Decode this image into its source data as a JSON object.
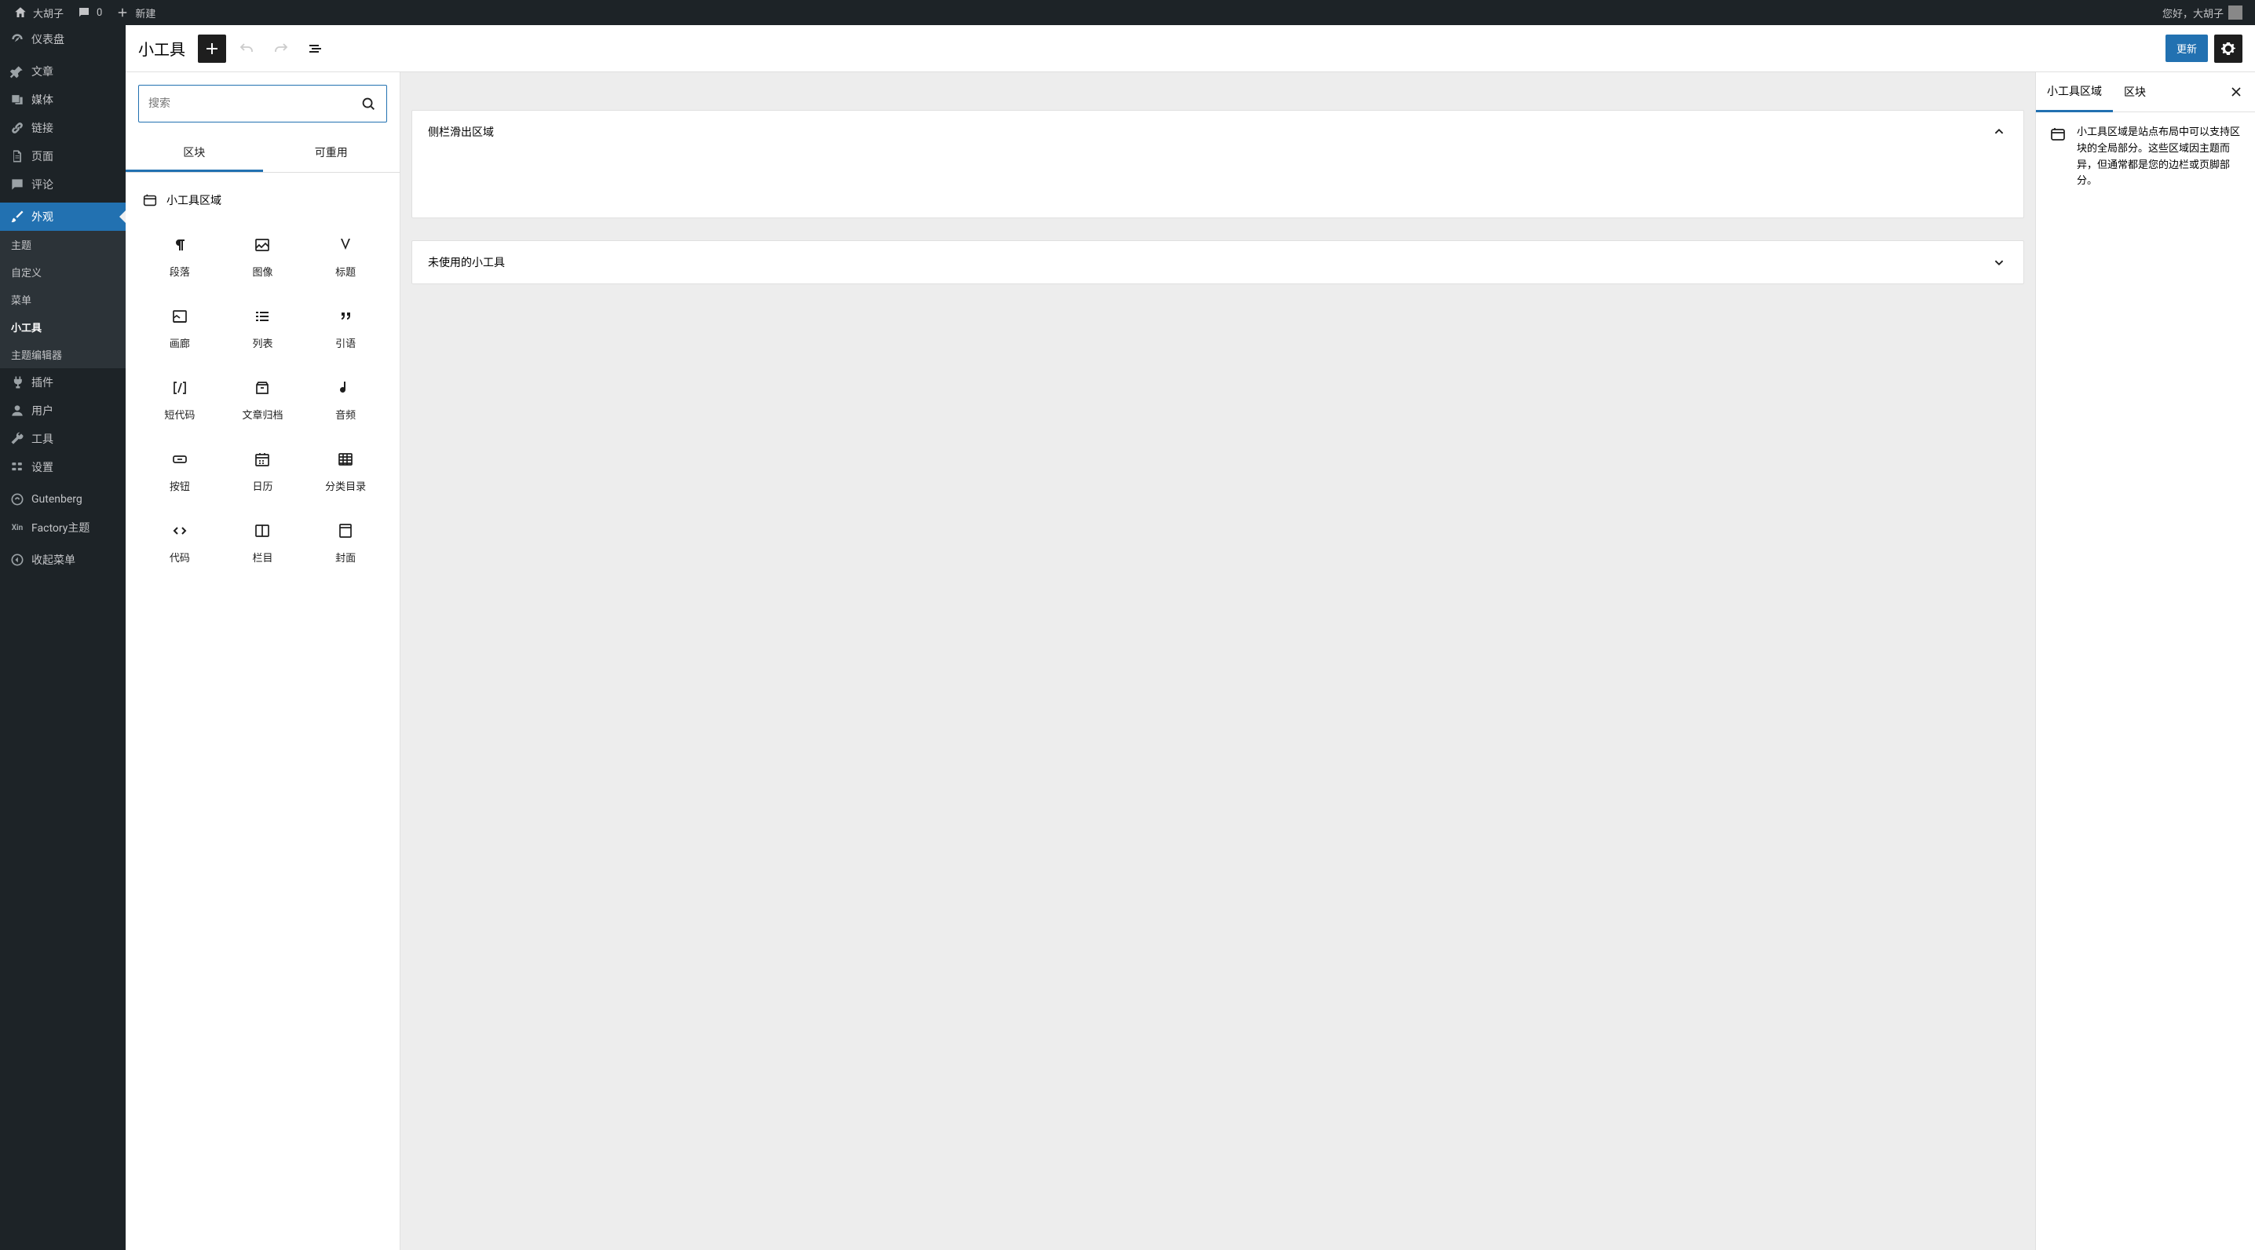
{
  "admin_bar": {
    "site_name": "大胡子",
    "comments_count": "0",
    "new_label": "新建",
    "greeting": "您好，大胡子"
  },
  "sidebar": {
    "items": [
      {
        "id": "dashboard",
        "label": "仪表盘",
        "icon": "dashboard"
      },
      {
        "id": "posts",
        "label": "文章",
        "icon": "pin"
      },
      {
        "id": "media",
        "label": "媒体",
        "icon": "media"
      },
      {
        "id": "links",
        "label": "链接",
        "icon": "link"
      },
      {
        "id": "pages",
        "label": "页面",
        "icon": "page"
      },
      {
        "id": "comments",
        "label": "评论",
        "icon": "comment"
      },
      {
        "id": "appearance",
        "label": "外观",
        "icon": "brush",
        "current": true,
        "submenu": [
          {
            "id": "themes",
            "label": "主题"
          },
          {
            "id": "customize",
            "label": "自定义"
          },
          {
            "id": "menus",
            "label": "菜单"
          },
          {
            "id": "widgets",
            "label": "小工具",
            "active": true
          },
          {
            "id": "theme-editor",
            "label": "主题编辑器"
          }
        ]
      },
      {
        "id": "plugins",
        "label": "插件",
        "icon": "plugin"
      },
      {
        "id": "users",
        "label": "用户",
        "icon": "user"
      },
      {
        "id": "tools",
        "label": "工具",
        "icon": "wrench"
      },
      {
        "id": "settings",
        "label": "设置",
        "icon": "settings"
      },
      {
        "id": "gutenberg",
        "label": "Gutenberg",
        "icon": "gutenberg"
      },
      {
        "id": "factory",
        "label": "Factory主题",
        "icon": "xin"
      },
      {
        "id": "collapse",
        "label": "收起菜单",
        "icon": "collapse"
      }
    ]
  },
  "editor_header": {
    "title": "小工具",
    "update_label": "更新"
  },
  "inserter": {
    "search_placeholder": "搜索",
    "tabs": {
      "blocks": "区块",
      "reusable": "可重用"
    },
    "category_title": "小工具区域",
    "blocks": [
      {
        "id": "paragraph",
        "label": "段落"
      },
      {
        "id": "image",
        "label": "图像"
      },
      {
        "id": "heading",
        "label": "标题"
      },
      {
        "id": "gallery",
        "label": "画廊"
      },
      {
        "id": "list",
        "label": "列表"
      },
      {
        "id": "quote",
        "label": "引语"
      },
      {
        "id": "shortcode",
        "label": "短代码"
      },
      {
        "id": "archives",
        "label": "文章归档"
      },
      {
        "id": "audio",
        "label": "音频"
      },
      {
        "id": "button",
        "label": "按钮"
      },
      {
        "id": "calendar",
        "label": "日历"
      },
      {
        "id": "categories",
        "label": "分类目录"
      },
      {
        "id": "code",
        "label": "代码"
      },
      {
        "id": "columns",
        "label": "栏目"
      },
      {
        "id": "cover",
        "label": "封面"
      }
    ]
  },
  "canvas": {
    "areas": [
      {
        "title": "侧栏滑出区域",
        "expanded": true
      },
      {
        "title": "未使用的小工具",
        "expanded": false
      }
    ]
  },
  "settings_panel": {
    "tabs": {
      "area": "小工具区域",
      "block": "区块"
    },
    "description": "小工具区域是站点布局中可以支持区块的全局部分。这些区域因主题而异，但通常都是您的边栏或页脚部分。"
  }
}
